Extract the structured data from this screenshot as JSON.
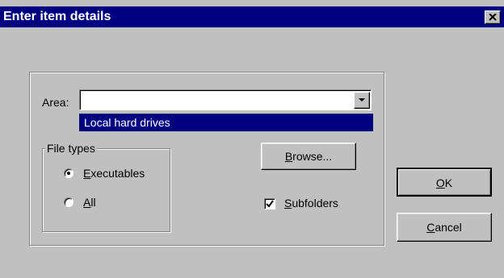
{
  "window": {
    "title": "Enter item details",
    "close_glyph": "close-icon"
  },
  "area": {
    "label": "Area:",
    "value": "",
    "dropdown_icon": "chevron-down-icon",
    "dropdown_option_selected": "Local hard drives"
  },
  "file_types": {
    "legend": "File types",
    "options": [
      {
        "mnemonic": "E",
        "rest": "xecutables",
        "selected": true
      },
      {
        "mnemonic": "A",
        "rest": "ll",
        "selected": false
      }
    ]
  },
  "browse_button": {
    "mnemonic": "B",
    "rest": "rowse..."
  },
  "subfolders": {
    "mnemonic": "S",
    "rest": "ubfolders",
    "checked": true
  },
  "ok_button": {
    "mnemonic": "O",
    "rest": "K"
  },
  "cancel_button": {
    "mnemonic": "C",
    "rest": "ancel"
  },
  "colors": {
    "title_bar": "#000080",
    "face": "#c0c0c0",
    "highlight": "#000080"
  }
}
